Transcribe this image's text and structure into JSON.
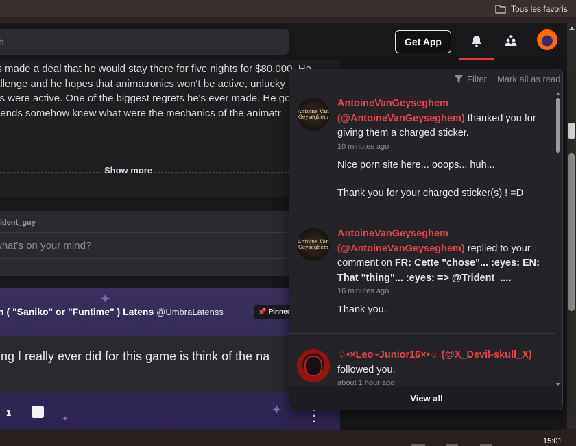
{
  "browser": {
    "bookmarks_folder": "Tous les favoris",
    "clock": "15:01"
  },
  "header": {
    "search_placeholder": "h",
    "get_app_label": "Get App"
  },
  "feed": {
    "post_lines": [
      "ls made a deal that he would stay there for five nights for $80,000. He",
      "allenge and he hopes that animatronics won't be active, unlucky",
      "cs were active. One of the biggest regrets he's ever made. He go",
      "riends somehow knew what were the mechanics of the animatr"
    ],
    "show_more": "Show more",
    "composer_user": "ident_guy",
    "composer_placeholder": "what's on your mind?",
    "pinned_title": "n ( \"Saniko\" or \"Funtime\" ) Latens",
    "pinned_handle": "@UmbraLatenss",
    "pinned_badge": "Pinned",
    "pinned_body": "ing I really ever did for this game is think of the na",
    "like_count": "1"
  },
  "notifications": {
    "filter_label": "Filter",
    "mark_all_label": "Mark all as read",
    "items": [
      {
        "avatar_text": "Antoine Van Geyseghem",
        "user": "AntoineVanGeyseghem (@AntoineVanGeyseghem)",
        "action": " thanked you for giving them a charged sticker.",
        "time": "10 minutes ago",
        "messages": [
          "Nice porn site here... ooops... huh...",
          "Thank you for your charged sticker(s) ! =D"
        ]
      },
      {
        "avatar_text": "Antoine Van Geyseghem",
        "user": "AntoineVanGeyseghem (@AntoineVanGeyseghem)",
        "action": " replied to your comment on ",
        "target": "FR: Cette \"chose\"... :eyes: EN: That \"thing\"... :eyes: => @Trident_....",
        "time": "16 minutes ago",
        "messages": [
          "Thank you."
        ]
      },
      {
        "user": "♤•×Leo~Junior16×•♤ (@X_Devil-skull_X)",
        "action": "followed you.",
        "time": "about 1 hour ago"
      }
    ],
    "view_all_label": "View all"
  },
  "colors": {
    "accent_red": "#e8414a",
    "panel_bg": "#232328",
    "page_bg": "#1f1f22"
  }
}
